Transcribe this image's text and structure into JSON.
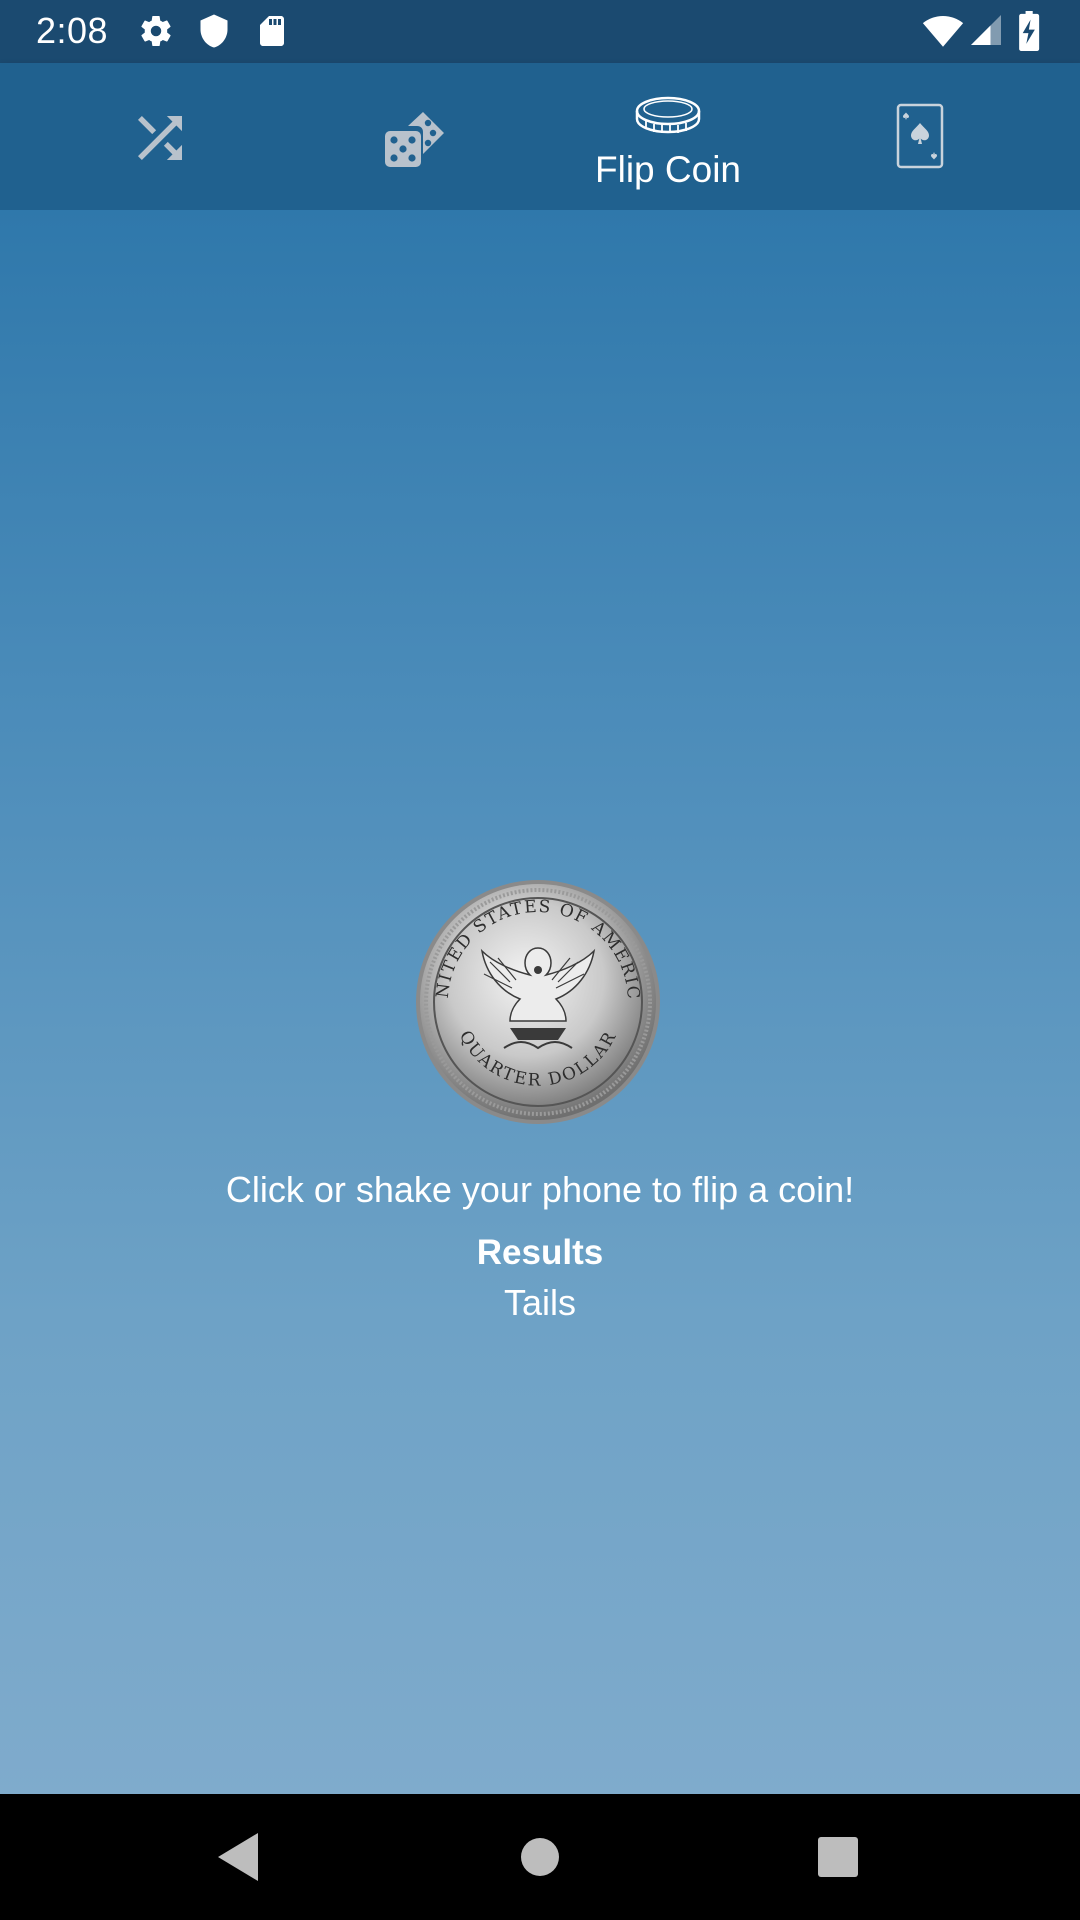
{
  "status_bar": {
    "time": "2:08",
    "icons": [
      "settings-gear-icon",
      "shield-icon",
      "sd-card-icon",
      "wifi-icon",
      "cell-signal-icon",
      "battery-charging-icon"
    ]
  },
  "tabs": [
    {
      "id": "shuffle",
      "icon": "shuffle-icon",
      "label": "",
      "active": false
    },
    {
      "id": "dice",
      "icon": "dice-icon",
      "label": "",
      "active": false
    },
    {
      "id": "flip-coin",
      "icon": "coin-icon",
      "label": "Flip Coin",
      "active": true
    },
    {
      "id": "cards",
      "icon": "playing-card-icon",
      "label": "",
      "active": false
    }
  ],
  "main": {
    "instruction": "Click or shake your phone to flip a coin!",
    "results_label": "Results",
    "result_value": "Tails"
  },
  "colors": {
    "status_bar": "#1b4a70",
    "tab_bar": "#20618f",
    "gradient_top": "#2f78ab",
    "gradient_bottom": "#7fabcc",
    "inactive_icon": "#b8c2cc",
    "text": "#ffffff"
  }
}
